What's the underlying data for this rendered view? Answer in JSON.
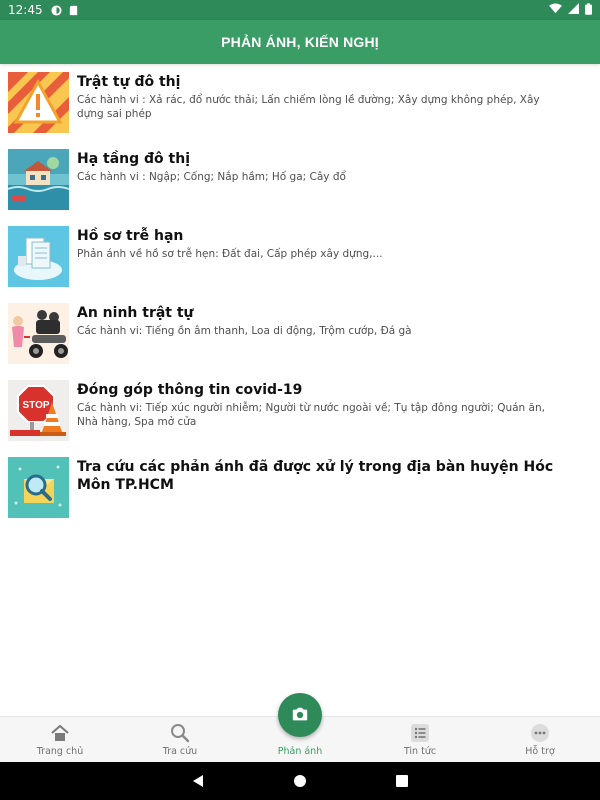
{
  "status_bar": {
    "time": "12:45",
    "icons": [
      "notification-icon",
      "sd-card-icon",
      "wifi-icon",
      "signal-icon",
      "battery-icon"
    ]
  },
  "header": {
    "title": "PHẢN ÁNH, KIẾN NGHỊ"
  },
  "items": [
    {
      "title": "Trật tự đô thị",
      "desc": "Các hành vi : Xả rác, đổ nước thải; Lấn chiếm lòng lề đường; Xây dựng không phép, Xây dựng sai phép",
      "icon": "warning-sign-icon"
    },
    {
      "title": "Hạ tầng đô thị",
      "desc": "Các hành vi : Ngập; Cống; Nắp hầm; Hố ga; Cây đổ",
      "icon": "flooded-house-icon"
    },
    {
      "title": "Hồ sơ trễ hạn",
      "desc": "Phản ánh về hồ sơ trễ hẹn: Đất đai, Cấp phép xây dựng,...",
      "icon": "documents-icon"
    },
    {
      "title": "An ninh trật tự",
      "desc": "Các hành vi: Tiếng ồn âm thanh, Loa di động, Trộm cướp, Đá gà",
      "icon": "motorbike-thieves-icon"
    },
    {
      "title": "Đóng góp thông tin covid-19",
      "desc": "Các hành vi: Tiếp xúc người nhiễm; Người từ nước ngoài về; Tụ tập đông người; Quán ăn, Nhà hàng, Spa mở cửa",
      "icon": "stop-sign-icon"
    },
    {
      "title": "Tra cứu các phản ánh đã được xử lý trong địa bàn huyện Hóc Môn TP.HCM",
      "desc": "",
      "icon": "magnifier-envelope-icon"
    }
  ],
  "bottom_nav": [
    {
      "label": "Trang chủ",
      "icon": "home-icon"
    },
    {
      "label": "Tra cứu",
      "icon": "search-icon"
    },
    {
      "label": "Phản ánh",
      "icon": "camera-icon",
      "active": true
    },
    {
      "label": "Tin tức",
      "icon": "news-list-icon"
    },
    {
      "label": "Hỗ trợ",
      "icon": "more-dots-icon"
    }
  ],
  "colors": {
    "header": "#3a9d66",
    "status_bar": "#2f8a59",
    "fab": "#2f8a59",
    "active_label": "#3a9d66"
  }
}
